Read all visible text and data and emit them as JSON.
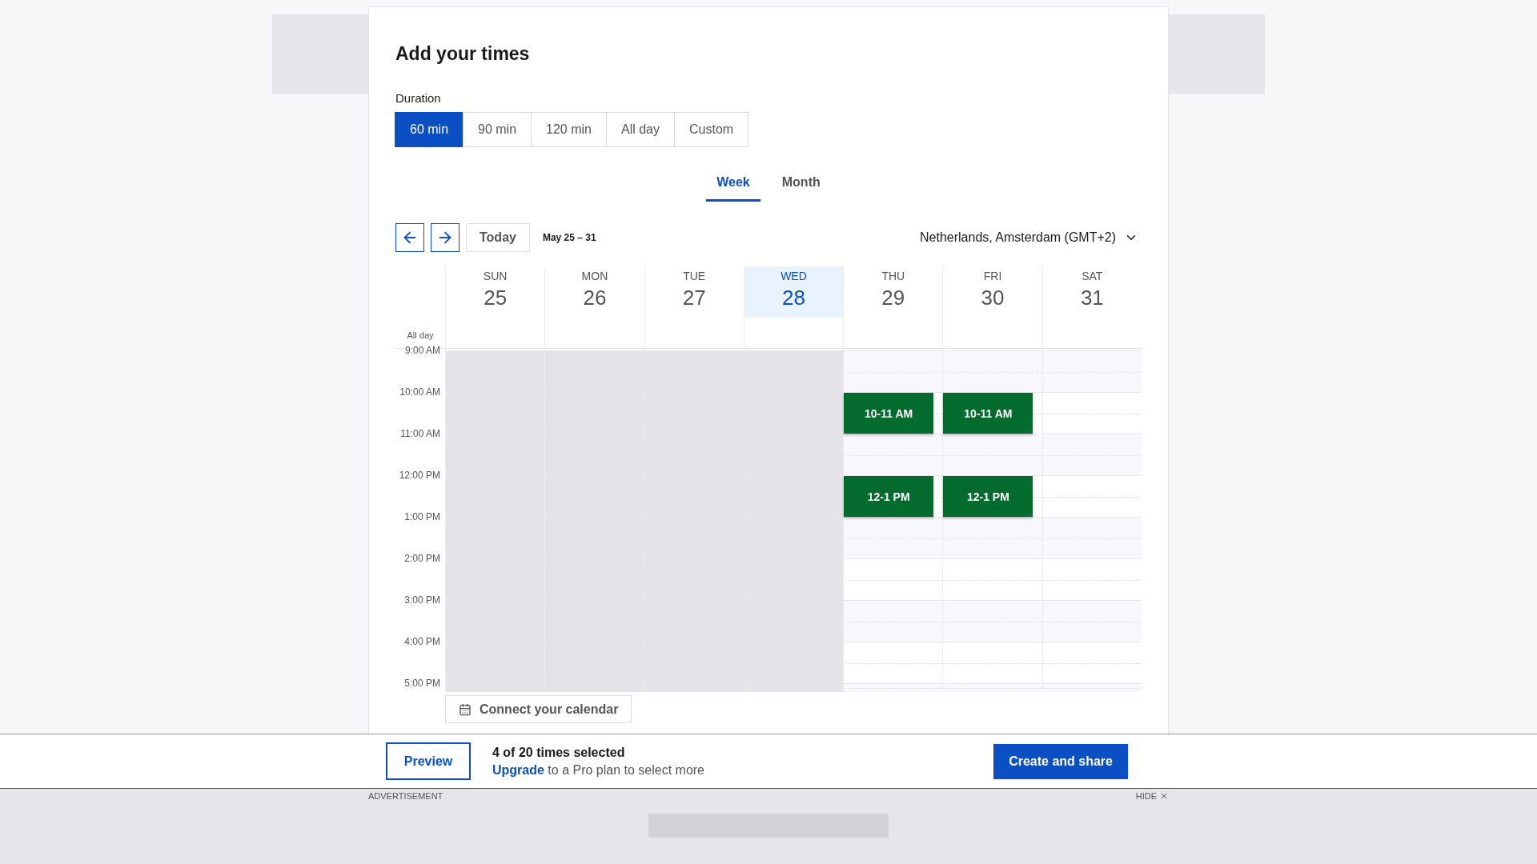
{
  "title": "Add your times",
  "duration": {
    "label": "Duration",
    "options": [
      {
        "label": "60 min",
        "selected": true
      },
      {
        "label": "90 min",
        "selected": false
      },
      {
        "label": "120 min",
        "selected": false
      },
      {
        "label": "All day",
        "selected": false
      },
      {
        "label": "Custom",
        "selected": false
      }
    ]
  },
  "view_tabs": [
    {
      "label": "Week",
      "selected": true
    },
    {
      "label": "Month",
      "selected": false
    }
  ],
  "nav": {
    "today": "Today",
    "range": "May 25 – 31",
    "timezone": "Netherlands, Amsterdam (GMT+2)"
  },
  "all_day_label": "All day",
  "days": [
    {
      "name": "SUN",
      "date": "25",
      "selected": false,
      "past": true
    },
    {
      "name": "MON",
      "date": "26",
      "selected": false,
      "past": true
    },
    {
      "name": "TUE",
      "date": "27",
      "selected": false,
      "past": true
    },
    {
      "name": "WED",
      "date": "28",
      "selected": true,
      "past": true
    },
    {
      "name": "THU",
      "date": "29",
      "selected": false,
      "past": false
    },
    {
      "name": "FRI",
      "date": "30",
      "selected": false,
      "past": false
    },
    {
      "name": "SAT",
      "date": "31",
      "selected": false,
      "past": false
    }
  ],
  "rows": [
    {
      "time": "9:00 AM",
      "slots": [
        {
          "selected": false
        },
        {
          "selected": false
        },
        {
          "selected": false
        },
        {
          "selected": false
        },
        {
          "selected": false
        },
        {
          "selected": false
        },
        {
          "selected": false
        }
      ]
    },
    {
      "time": "10:00 AM",
      "slots": [
        {
          "selected": false
        },
        {
          "selected": false
        },
        {
          "selected": false
        },
        {
          "selected": false
        },
        {
          "selected": true,
          "label": "10-11 AM"
        },
        {
          "selected": true,
          "label": "10-11 AM"
        },
        {
          "selected": false
        }
      ]
    },
    {
      "time": "11:00 AM",
      "slots": [
        {
          "selected": false
        },
        {
          "selected": false
        },
        {
          "selected": false
        },
        {
          "selected": false
        },
        {
          "selected": false
        },
        {
          "selected": false
        },
        {
          "selected": false
        }
      ]
    },
    {
      "time": "12:00 PM",
      "slots": [
        {
          "selected": false
        },
        {
          "selected": false
        },
        {
          "selected": false
        },
        {
          "selected": false
        },
        {
          "selected": true,
          "label": "12-1 PM"
        },
        {
          "selected": true,
          "label": "12-1 PM"
        },
        {
          "selected": false
        }
      ]
    },
    {
      "time": "1:00 PM",
      "slots": [
        {
          "selected": false
        },
        {
          "selected": false
        },
        {
          "selected": false
        },
        {
          "selected": false
        },
        {
          "selected": false
        },
        {
          "selected": false
        },
        {
          "selected": false
        }
      ]
    },
    {
      "time": "2:00 PM",
      "slots": [
        {
          "selected": false
        },
        {
          "selected": false
        },
        {
          "selected": false
        },
        {
          "selected": false
        },
        {
          "selected": false
        },
        {
          "selected": false
        },
        {
          "selected": false
        }
      ]
    },
    {
      "time": "3:00 PM",
      "slots": [
        {
          "selected": false
        },
        {
          "selected": false
        },
        {
          "selected": false
        },
        {
          "selected": false
        },
        {
          "selected": false
        },
        {
          "selected": false
        },
        {
          "selected": false
        }
      ]
    },
    {
      "time": "4:00 PM",
      "slots": [
        {
          "selected": false
        },
        {
          "selected": false
        },
        {
          "selected": false
        },
        {
          "selected": false
        },
        {
          "selected": false
        },
        {
          "selected": false
        },
        {
          "selected": false
        }
      ]
    },
    {
      "time": "5:00 PM",
      "slots": [
        {
          "selected": false
        },
        {
          "selected": false
        },
        {
          "selected": false
        },
        {
          "selected": false
        },
        {
          "selected": false
        },
        {
          "selected": false
        },
        {
          "selected": false
        }
      ]
    }
  ],
  "connect_calendar": "Connect your calendar",
  "footer": {
    "preview": "Preview",
    "count": "4 of 20 times selected",
    "upgrade_link": "Upgrade",
    "upgrade_text": "to a Pro plan to select more",
    "create": "Create and share"
  },
  "ad": {
    "label": "ADVERTISEMENT",
    "hide": "HIDE"
  }
}
